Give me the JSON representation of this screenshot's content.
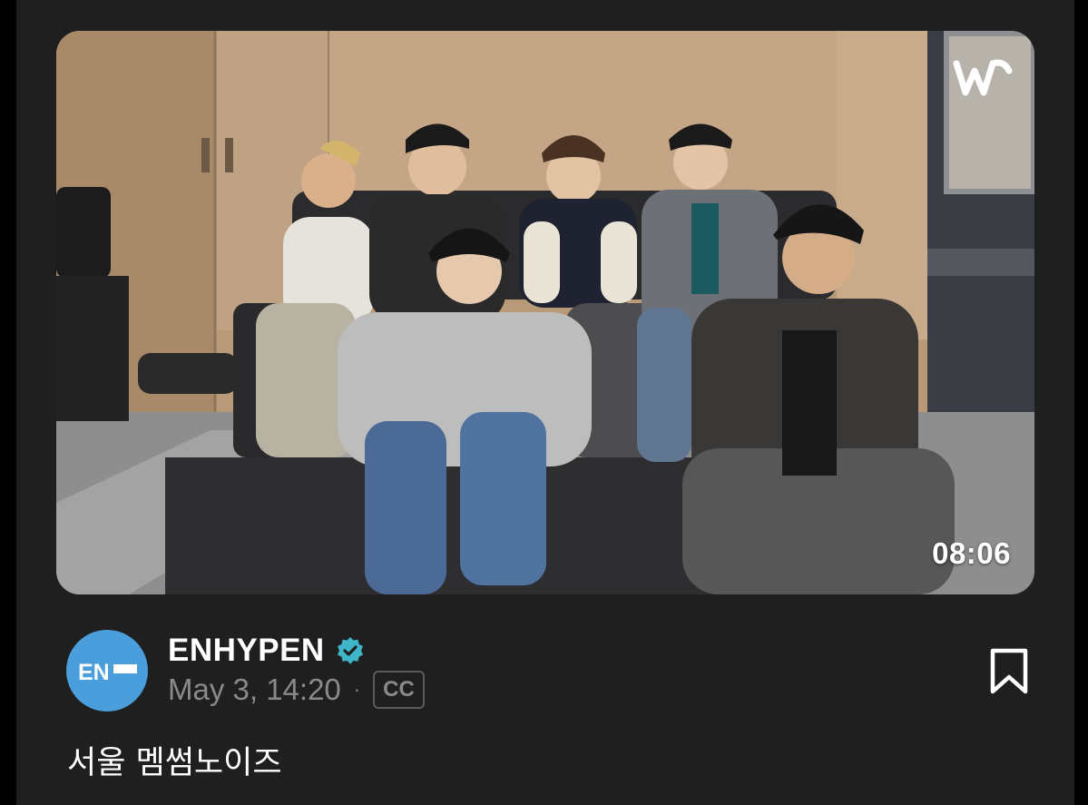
{
  "video": {
    "duration": "08:06",
    "watermark_icon": "weverse-logo-icon"
  },
  "post": {
    "channel_name": "ENHYPEN",
    "avatar_text": "EN-",
    "verified_icon": "verified-badge-icon",
    "date": "May 3, 14:20",
    "separator": "·",
    "cc_label": "CC",
    "bookmark_icon": "bookmark-icon",
    "caption": "서울 멤썸노이즈"
  },
  "colors": {
    "background": "#1f1f1f",
    "avatar": "#4a9edb",
    "verified": "#3fb5c9",
    "meta_text": "#8a8a8a"
  }
}
